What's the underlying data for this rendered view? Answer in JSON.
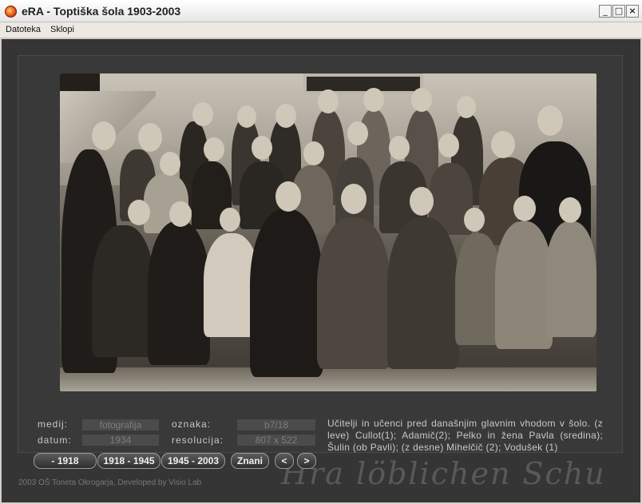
{
  "window": {
    "title": "eRA - Toptiška šola 1903-2003",
    "buttons": {
      "minimize": "_",
      "maximize": "□",
      "close": "×"
    }
  },
  "menu": {
    "items": [
      "Datoteka",
      "Sklopi"
    ]
  },
  "info": {
    "medij_label": "medij:",
    "medij_value": "fotografija",
    "datum_label": "datum:",
    "datum_value": "1934",
    "oznaka_label": "oznaka:",
    "oznaka_value": "b7/18",
    "resolucija_label": "resolucija:",
    "resolucija_value": "807 x 522"
  },
  "description": "Učitelji in učenci pred današnjim glavnim vhodom v šolo. (z leve) Cullot(1); Adamič(2); Pelko in žena Pavla (sredina); Šulin (ob Pavli); (z desne) Mihelčič (2); Vodušek (1)",
  "nav": {
    "b1": "- 1918",
    "b2": "1918 - 1945",
    "b3": "1945 - 2003",
    "b4": "Znani",
    "prev": "<",
    "next": ">"
  },
  "footer": "2003 OŠ Toneta Okrogarja, Developed by Visio Lab",
  "watermark": "Hra löblichen Schu",
  "colors": {
    "background": "#353535",
    "accent": "#e2581e"
  }
}
